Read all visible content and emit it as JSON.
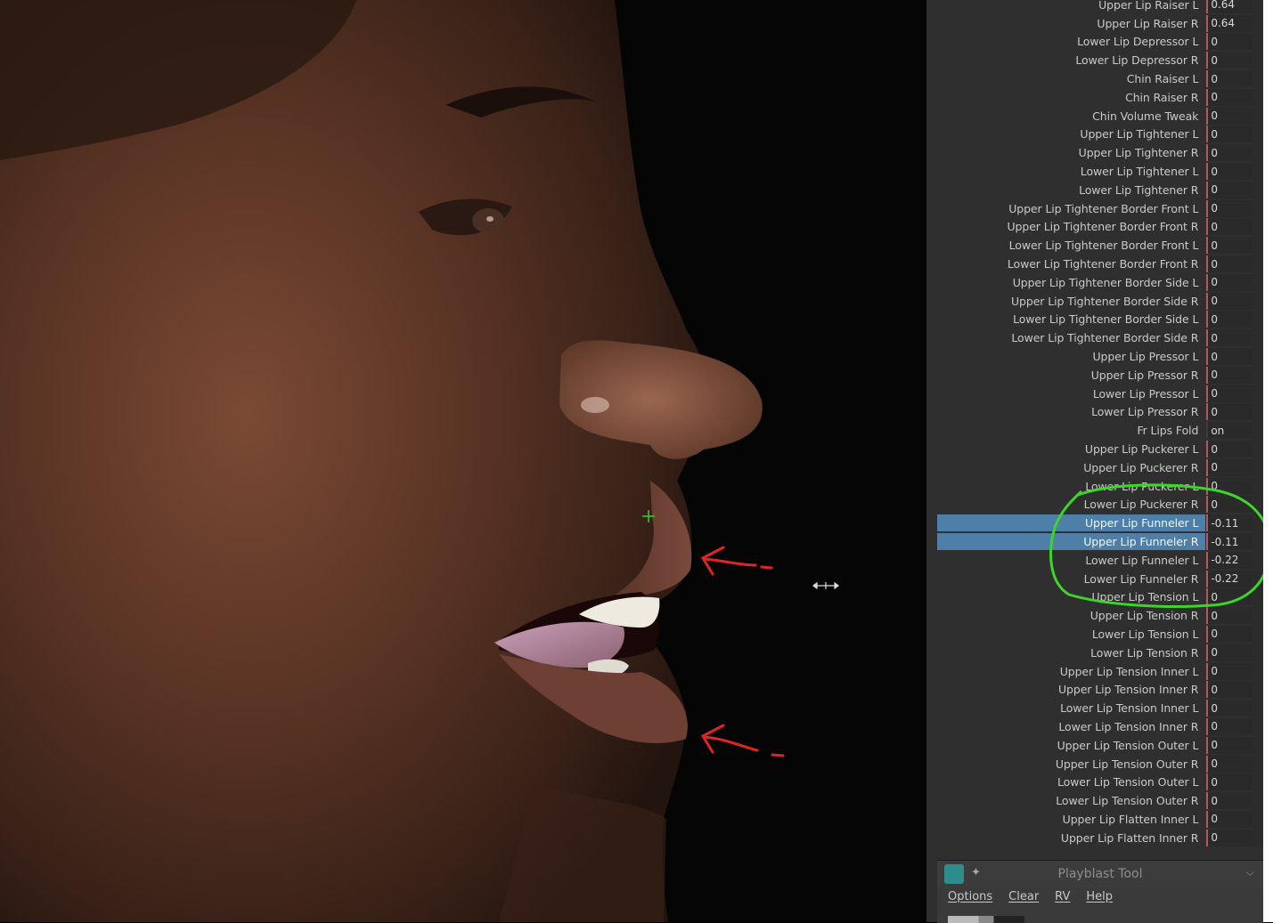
{
  "attributes": [
    {
      "label": "Upper Lip Raiser L",
      "value": "0.64"
    },
    {
      "label": "Upper Lip Raiser R",
      "value": "0.64"
    },
    {
      "label": "Lower Lip Depressor L",
      "value": "0"
    },
    {
      "label": "Lower Lip Depressor R",
      "value": "0"
    },
    {
      "label": "Chin Raiser L",
      "value": "0"
    },
    {
      "label": "Chin Raiser R",
      "value": "0"
    },
    {
      "label": "Chin Volume Tweak",
      "value": "0"
    },
    {
      "label": "Upper Lip Tightener L",
      "value": "0"
    },
    {
      "label": "Upper Lip Tightener R",
      "value": "0"
    },
    {
      "label": "Lower Lip Tightener L",
      "value": "0"
    },
    {
      "label": "Lower Lip Tightener R",
      "value": "0"
    },
    {
      "label": "Upper Lip Tightener Border Front L",
      "value": "0"
    },
    {
      "label": "Upper Lip Tightener Border Front R",
      "value": "0"
    },
    {
      "label": "Lower Lip Tightener Border Front L",
      "value": "0"
    },
    {
      "label": "Lower Lip Tightener Border Front R",
      "value": "0"
    },
    {
      "label": "Upper Lip Tightener Border Side L",
      "value": "0"
    },
    {
      "label": "Upper Lip Tightener Border Side R",
      "value": "0"
    },
    {
      "label": "Lower Lip Tightener Border Side L",
      "value": "0"
    },
    {
      "label": "Lower Lip Tightener Border Side R",
      "value": "0"
    },
    {
      "label": "Upper Lip Pressor L",
      "value": "0"
    },
    {
      "label": "Upper Lip Pressor R",
      "value": "0"
    },
    {
      "label": "Lower Lip Pressor L",
      "value": "0"
    },
    {
      "label": "Lower Lip Pressor R",
      "value": "0"
    },
    {
      "label": "Fr Lips Fold",
      "value": "on",
      "nonkey": true
    },
    {
      "label": "Upper Lip Puckerer L",
      "value": "0"
    },
    {
      "label": "Upper Lip Puckerer R",
      "value": "0"
    },
    {
      "label": "Lower Lip Puckerer L",
      "value": "0"
    },
    {
      "label": "Lower Lip Puckerer R",
      "value": "0"
    },
    {
      "label": "Upper Lip Funneler L",
      "value": "-0.11",
      "selected": true
    },
    {
      "label": "Upper Lip Funneler R",
      "value": "-0.11",
      "selected": true
    },
    {
      "label": "Lower Lip Funneler L",
      "value": "-0.22"
    },
    {
      "label": "Lower Lip Funneler R",
      "value": "-0.22"
    },
    {
      "label": "Upper Lip Tension L",
      "value": "0"
    },
    {
      "label": "Upper Lip Tension R",
      "value": "0"
    },
    {
      "label": "Lower Lip Tension L",
      "value": "0"
    },
    {
      "label": "Lower Lip Tension R",
      "value": "0"
    },
    {
      "label": "Upper Lip Tension Inner L",
      "value": "0"
    },
    {
      "label": "Upper Lip Tension Inner R",
      "value": "0"
    },
    {
      "label": "Lower Lip Tension Inner L",
      "value": "0"
    },
    {
      "label": "Lower Lip Tension Inner R",
      "value": "0"
    },
    {
      "label": "Upper Lip Tension Outer L",
      "value": "0"
    },
    {
      "label": "Upper Lip Tension Outer R",
      "value": "0"
    },
    {
      "label": "Lower Lip Tension Outer L",
      "value": "0"
    },
    {
      "label": "Lower Lip Tension Outer R",
      "value": "0"
    },
    {
      "label": "Upper Lip Flatten Inner L",
      "value": "0"
    },
    {
      "label": "Upper Lip Flatten Inner R",
      "value": "0"
    }
  ],
  "playblast": {
    "title": "Playblast Tool",
    "icon": "playblast-icon",
    "menu": [
      "Options",
      "Clear",
      "RV",
      "Help"
    ]
  },
  "colors": {
    "selection": "#4d7fa8",
    "key_marker": "#b55a5a",
    "annotation_circle": "#3fd42a",
    "annotation_arrow": "#e02424"
  }
}
